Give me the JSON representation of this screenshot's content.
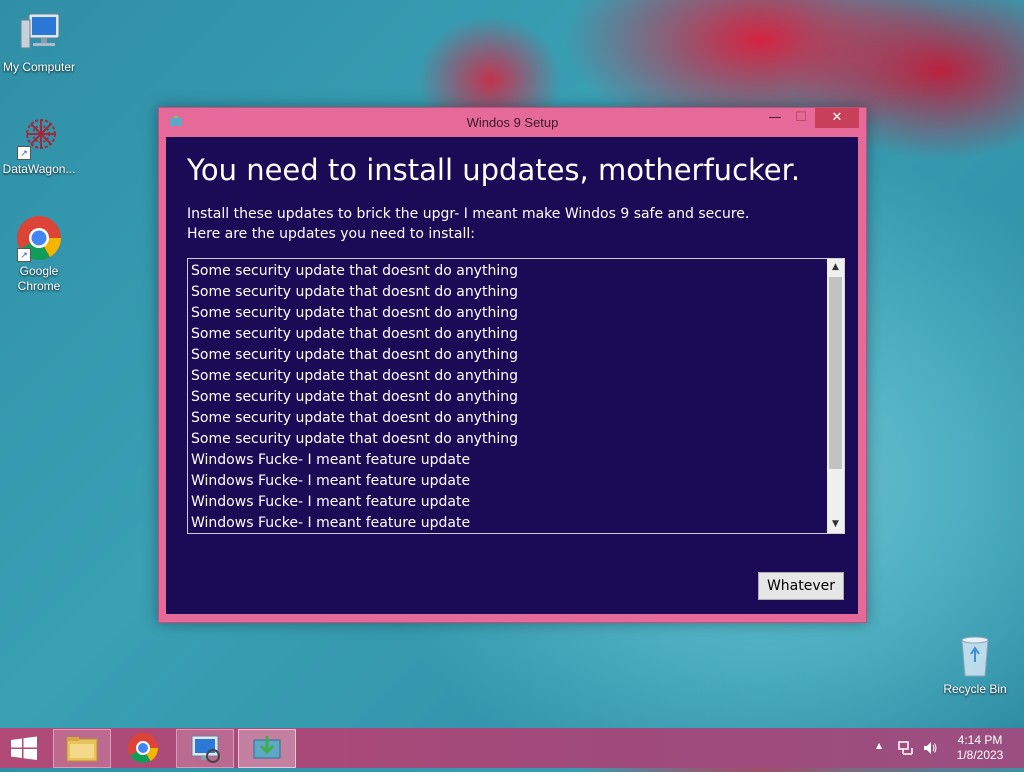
{
  "desktop": {
    "icons": [
      {
        "label": "My Computer"
      },
      {
        "label": "DataWagon..."
      },
      {
        "label": "Google\nChrome"
      },
      {
        "label": "Recycle Bin"
      }
    ]
  },
  "window": {
    "title": "Windos 9 Setup",
    "minimize_glyph": "—",
    "maximize_glyph": "☐",
    "close_glyph": "✕",
    "heading": "You need to install updates, motherfucker.",
    "description_line1": "Install these updates to brick the upgr- I meant make Windos 9 safe and secure.",
    "description_line2": "Here are the updates you need to install:",
    "updates": [
      "Some security update that doesnt do anything",
      "Some security update that doesnt do anything",
      "Some security update that doesnt do anything",
      "Some security update that doesnt do anything",
      "Some security update that doesnt do anything",
      "Some security update that doesnt do anything",
      "Some security update that doesnt do anything",
      "Some security update that doesnt do anything",
      "Some security update that doesnt do anything",
      "Windows Fucke- I meant feature update",
      "Windows Fucke- I meant feature update",
      "Windows Fucke- I meant feature update",
      "Windows Fucke- I meant feature update"
    ],
    "scroll_up_glyph": "▲",
    "scroll_down_glyph": "▼",
    "action_button": "Whatever"
  },
  "taskbar": {
    "clock_time": "4:14 PM",
    "clock_date": "1/8/2023",
    "tray_chevron": "▲"
  },
  "colors": {
    "window_frame": "#e56a9a",
    "window_client": "#1b0a55",
    "taskbar": "#a04a7c"
  }
}
